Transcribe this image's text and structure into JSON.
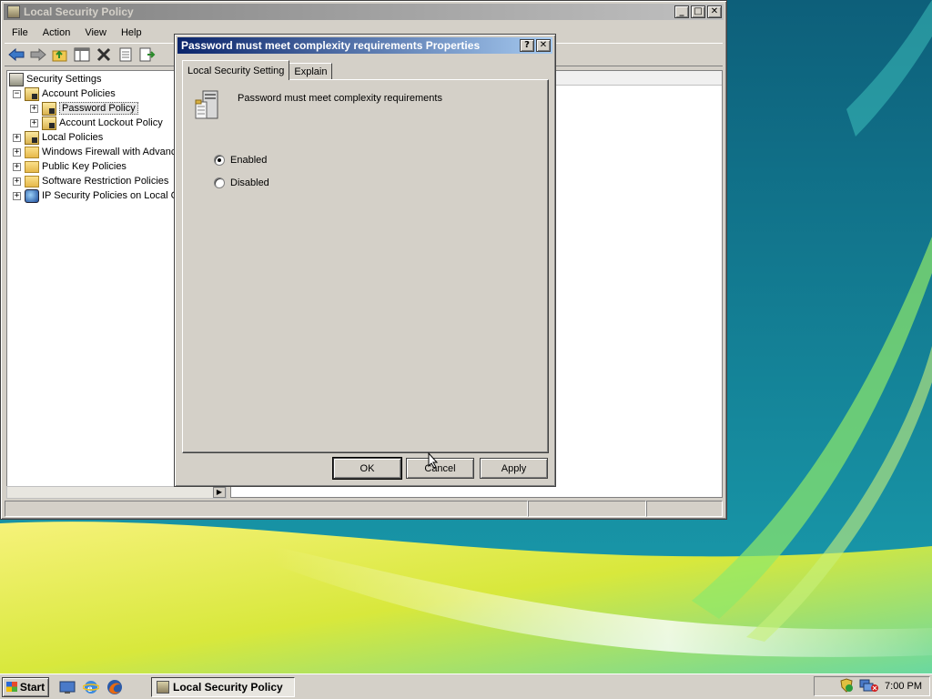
{
  "main_window": {
    "title": "Local Security Policy",
    "menu": [
      "File",
      "Action",
      "View",
      "Help"
    ],
    "tree": {
      "root": "Security Settings",
      "account_policies": "Account Policies",
      "password_policy": "Password Policy",
      "account_lockout_policy": "Account Lockout Policy",
      "local_policies": "Local Policies",
      "windows_firewall": "Windows Firewall with Advanc",
      "public_key_policies": "Public Key Policies",
      "software_restriction_policies": "Software Restriction Policies",
      "ip_security_policies": "IP Security Policies on Local C"
    }
  },
  "dialog": {
    "title": "Password must meet complexity requirements Properties",
    "tabs": [
      "Local Security Setting",
      "Explain"
    ],
    "policy_name": "Password must meet complexity requirements",
    "options": {
      "enabled_label": "Enabled",
      "disabled_label": "Disabled",
      "selected": "Enabled"
    },
    "buttons": {
      "ok": "OK",
      "cancel": "Cancel",
      "apply": "Apply"
    },
    "help_glyph": "?",
    "close_glyph": "✕"
  },
  "window_controls": {
    "minimize": "_",
    "maximize": "□",
    "close": "✕"
  },
  "taskbar": {
    "start_label": "Start",
    "task_label": "Local Security Policy",
    "clock": "7:00 PM"
  },
  "icons": {
    "back": "back-arrow-icon",
    "forward": "forward-arrow-icon",
    "up": "up-folder-icon",
    "show_hide_tree": "show-hide-tree-icon",
    "delete": "delete-icon",
    "properties": "properties-icon",
    "export": "export-list-icon"
  }
}
